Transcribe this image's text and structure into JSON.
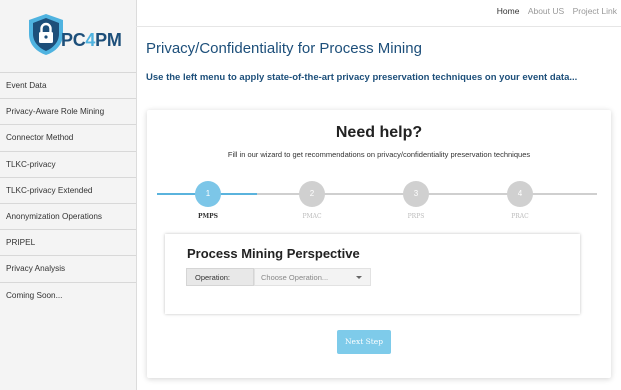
{
  "logo": {
    "text_pc": "PC",
    "text_4": "4",
    "text_pm": "PM",
    "icon": "lock-shield-icon",
    "brand_color": "#1d4f7a",
    "accent_color": "#4fb3e0"
  },
  "topnav": {
    "items": [
      "Home",
      "About US",
      "Project Link"
    ],
    "active": "Home"
  },
  "sidebar": {
    "items": [
      {
        "label": "Event Data"
      },
      {
        "label": "Privacy-Aware Role Mining"
      },
      {
        "label": "Connector Method"
      },
      {
        "label": "TLKC-privacy"
      },
      {
        "label": "TLKC-privacy Extended"
      },
      {
        "label": "Anonymization Operations"
      },
      {
        "label": "PRIPEL"
      },
      {
        "label": "Privacy Analysis"
      },
      {
        "label": "Coming Soon..."
      }
    ]
  },
  "main": {
    "title": "Privacy/Confidentiality for Process Mining",
    "subtitle": "Use the left menu to apply state-of-the-art privacy preservation techniques on your event data..."
  },
  "wizard": {
    "title": "Need help?",
    "description": "Fill in our wizard to get recommendations on privacy/confidentiality preservation techniques",
    "steps": [
      {
        "number": "1",
        "label": "PMPS",
        "active": true
      },
      {
        "number": "2",
        "label": "PMAC",
        "active": false
      },
      {
        "number": "3",
        "label": "PRPS",
        "active": false
      },
      {
        "number": "4",
        "label": "PRAC",
        "active": false
      }
    ],
    "panel_title": "Process Mining Perspective",
    "operation_label": "Operation:",
    "operation_placeholder": "Choose Operation...",
    "next_button": "Next Step",
    "active_color": "#7cc6e8",
    "inactive_color": "#d0d0d0"
  }
}
